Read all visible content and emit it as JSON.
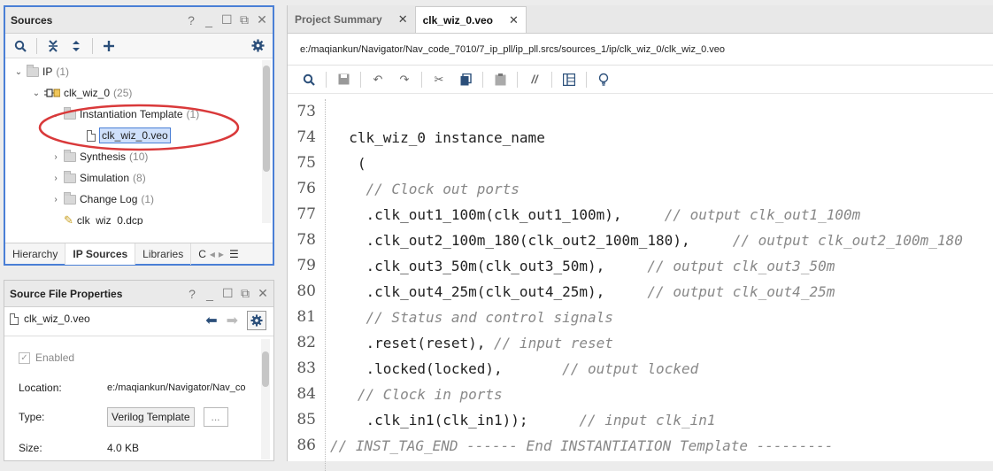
{
  "sources": {
    "title": "Sources",
    "tree": [
      {
        "label": "IP",
        "count": "(1)"
      },
      {
        "label": "clk_wiz_0",
        "count": "(25)"
      },
      {
        "label": "Instantiation Template",
        "count": "(1)"
      },
      {
        "label": "clk_wiz_0.veo",
        "count": ""
      },
      {
        "label": "Synthesis",
        "count": "(10)"
      },
      {
        "label": "Simulation",
        "count": "(8)"
      },
      {
        "label": "Change Log",
        "count": "(1)"
      },
      {
        "label": "clk_wiz_0.dcp",
        "count": ""
      }
    ],
    "tabs": [
      "Hierarchy",
      "IP Sources",
      "Libraries",
      "C"
    ]
  },
  "props": {
    "title": "Source File Properties",
    "file": "clk_wiz_0.veo",
    "enabled": "Enabled",
    "location_label": "Location:",
    "location_value": "e:/maqiankun/Navigator/Nav_co",
    "type_label": "Type:",
    "type_value": "Verilog Template",
    "browse": "...",
    "size_label": "Size:",
    "size_value": "4.0 KB"
  },
  "editor": {
    "tabs": [
      "Project Summary",
      "clk_wiz_0.veo"
    ],
    "path": "e:/maqiankun/Navigator/Nav_code_7010/7_ip_pll/ip_pll.srcs/sources_1/ip/clk_wiz_0/clk_wiz_0.veo",
    "lines": [
      {
        "no": "73",
        "code": "",
        "comment": ""
      },
      {
        "no": "74",
        "code": "  clk_wiz_0 instance_name",
        "comment": ""
      },
      {
        "no": "75",
        "code": "   (",
        "comment": ""
      },
      {
        "no": "76",
        "code": "    ",
        "comment": "// Clock out ports"
      },
      {
        "no": "77",
        "code": "    .clk_out1_100m(clk_out1_100m),     ",
        "comment": "// output clk_out1_100m"
      },
      {
        "no": "78",
        "code": "    .clk_out2_100m_180(clk_out2_100m_180),     ",
        "comment": "// output clk_out2_100m_180"
      },
      {
        "no": "79",
        "code": "    .clk_out3_50m(clk_out3_50m),     ",
        "comment": "// output clk_out3_50m"
      },
      {
        "no": "80",
        "code": "    .clk_out4_25m(clk_out4_25m),     ",
        "comment": "// output clk_out4_25m"
      },
      {
        "no": "81",
        "code": "    ",
        "comment": "// Status and control signals"
      },
      {
        "no": "82",
        "code": "    .reset(reset), ",
        "comment": "// input reset"
      },
      {
        "no": "83",
        "code": "    .locked(locked),       ",
        "comment": "// output locked"
      },
      {
        "no": "84",
        "code": "   ",
        "comment": "// Clock in ports"
      },
      {
        "no": "85",
        "code": "    .clk_in1(clk_in1));      ",
        "comment": "// input clk_in1"
      },
      {
        "no": "86",
        "code": "",
        "comment": "// INST_TAG_END ------ End INSTANTIATION Template ---------"
      }
    ]
  },
  "colors": {
    "highlight_circle": "#d9393a",
    "panel_border": "#4a7fd6"
  }
}
